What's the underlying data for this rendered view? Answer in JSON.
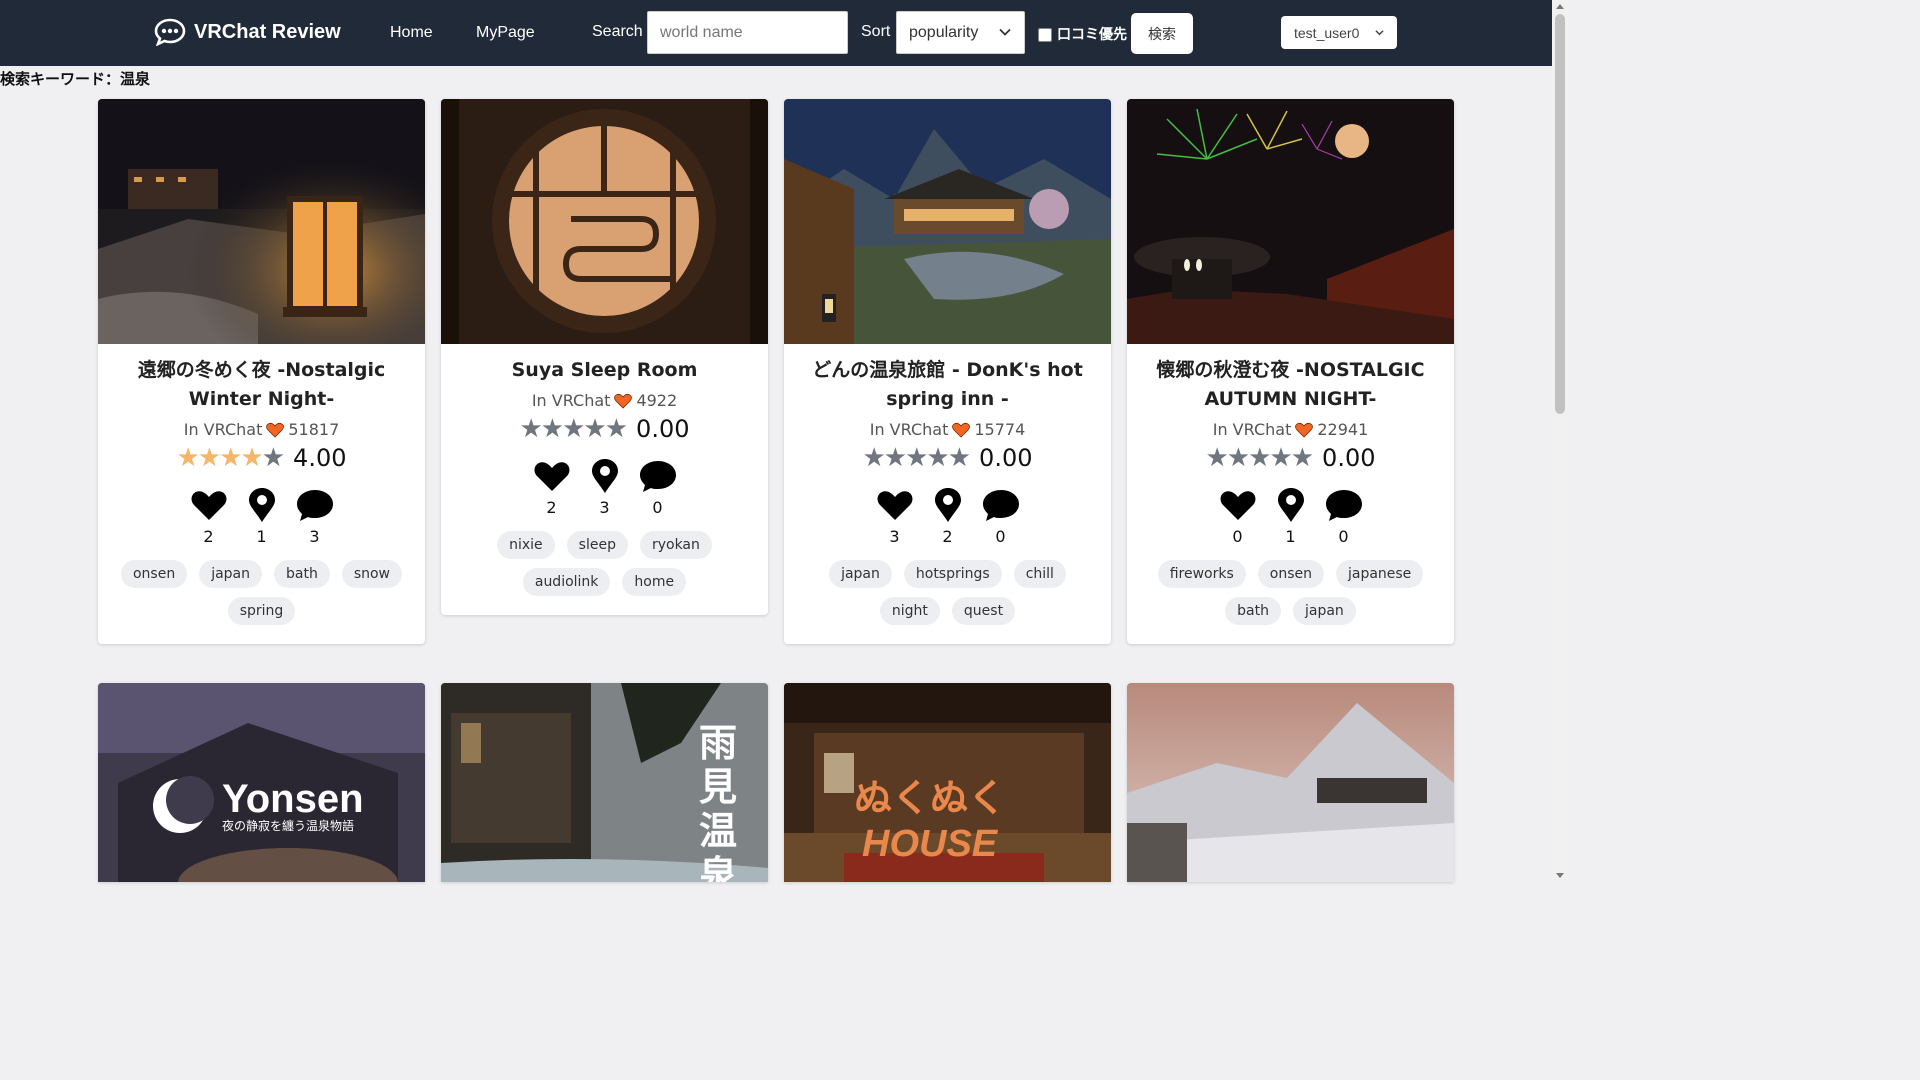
{
  "navbar": {
    "brand": "VRChat Review",
    "links": [
      "Home",
      "MyPage"
    ],
    "search_label": "Search",
    "search_placeholder": "world name",
    "sort_label": "Sort",
    "sort_value": "popularity",
    "review_priority_label": "口コミ優先",
    "search_button": "検索",
    "user": "test_user0"
  },
  "keyword": "検索キーワード：温泉",
  "colors": {
    "navbar": "#212a38",
    "star_on": "#f5b66a",
    "star_off": "#6f7680",
    "heart_small": "#f26522"
  },
  "cards": [
    {
      "title": "遠郷の冬めく夜 -Nostalgic Winter Night-",
      "platform": "In VRChat",
      "favorites": "51817",
      "stars": 4,
      "rating": "4.00",
      "likes": "2",
      "visits": "1",
      "comments": "3",
      "tags": [
        "onsen",
        "japan",
        "bath",
        "snow",
        "spring"
      ]
    },
    {
      "title": "Suya Sleep Room",
      "platform": "In VRChat",
      "favorites": "4922",
      "stars": 0,
      "rating": "0.00",
      "likes": "2",
      "visits": "3",
      "comments": "0",
      "tags": [
        "nixie",
        "sleep",
        "ryokan",
        "audiolink",
        "home"
      ]
    },
    {
      "title": "どんの温泉旅館 - DonK's hot spring inn -",
      "platform": "In VRChat",
      "favorites": "15774",
      "stars": 0,
      "rating": "0.00",
      "likes": "3",
      "visits": "2",
      "comments": "0",
      "tags": [
        "japan",
        "hotsprings",
        "chill",
        "night",
        "quest"
      ]
    },
    {
      "title": "懐郷の秋澄む夜 -NOSTALGIC AUTUMN NIGHT-",
      "platform": "In VRChat",
      "favorites": "22941",
      "stars": 0,
      "rating": "0.00",
      "likes": "0",
      "visits": "1",
      "comments": "0",
      "tags": [
        "fireworks",
        "onsen",
        "japanese",
        "bath",
        "japan"
      ]
    }
  ],
  "bottom_cards": [
    {
      "overlay_title": "Yonsen",
      "overlay_sub": "夜の静寂を纏う温泉物語"
    },
    {
      "overlay_title": "雨見温泉"
    },
    {
      "overlay_title": "ぬくぬく",
      "overlay_sub": "HOUSE"
    },
    {}
  ]
}
